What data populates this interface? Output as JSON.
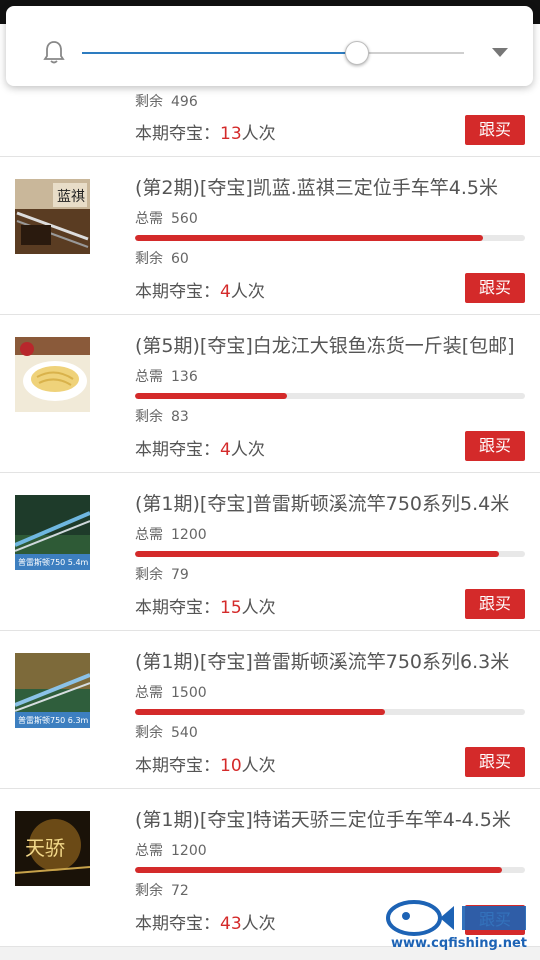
{
  "brightness": {
    "level": 0.72
  },
  "items": [
    {
      "title": "",
      "total_label": "",
      "total": "",
      "remain_label": "剩余",
      "remain": "496",
      "period_label": "本期夺宝：",
      "period_count": "13",
      "period_suffix": "人次",
      "progress": 0,
      "button": "跟买",
      "thumb_icon": ""
    },
    {
      "title": "(第2期)[夺宝]凯蓝.蓝祺三定位手车竿4.5米",
      "total_label": "总需",
      "total": "560",
      "remain_label": "剩余",
      "remain": "60",
      "period_label": "本期夺宝：",
      "period_count": "4",
      "period_suffix": "人次",
      "progress": 0.893,
      "button": "跟买",
      "thumb_icon": "fishing-rod-box-image"
    },
    {
      "title": "(第5期)[夺宝]白龙江大银鱼冻货一斤装[包邮]",
      "total_label": "总需",
      "total": "136",
      "remain_label": "剩余",
      "remain": "83",
      "period_label": "本期夺宝：",
      "period_count": "4",
      "period_suffix": "人次",
      "progress": 0.39,
      "button": "跟买",
      "thumb_icon": "silverfish-plate-image"
    },
    {
      "title": "(第1期)[夺宝]普雷斯顿溪流竿750系列5.4米",
      "total_label": "总需",
      "total": "1200",
      "remain_label": "剩余",
      "remain": "79",
      "period_label": "本期夺宝：",
      "period_count": "15",
      "period_suffix": "人次",
      "progress": 0.934,
      "button": "跟买",
      "thumb_icon": "preston-rod-image",
      "thumb_caption": "普雷斯顿750 5.4m"
    },
    {
      "title": "(第1期)[夺宝]普雷斯顿溪流竿750系列6.3米",
      "total_label": "总需",
      "total": "1500",
      "remain_label": "剩余",
      "remain": "540",
      "period_label": "本期夺宝：",
      "period_count": "10",
      "period_suffix": "人次",
      "progress": 0.64,
      "button": "跟买",
      "thumb_icon": "preston-rod-image",
      "thumb_caption": "普雷斯顿750 6.3m"
    },
    {
      "title": "(第1期)[夺宝]特诺天骄三定位手车竿4-4.5米",
      "total_label": "总需",
      "total": "1200",
      "remain_label": "剩余",
      "remain": "72",
      "period_label": "本期夺宝：",
      "period_count": "43",
      "period_suffix": "人次",
      "progress": 0.94,
      "button": "跟买",
      "thumb_icon": "tianjiao-rod-image",
      "thumb_caption": "天骄"
    }
  ],
  "watermark": {
    "text": "www.cqfishing.net"
  }
}
